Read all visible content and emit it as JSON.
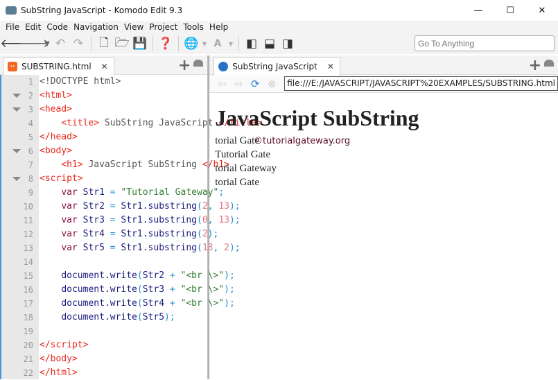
{
  "window": {
    "title": "SubString JavaScript - Komodo Edit 9.3",
    "controls": [
      "—",
      "☐",
      "✕"
    ]
  },
  "menu": [
    "File",
    "Edit",
    "Code",
    "Navigation",
    "View",
    "Project",
    "Tools",
    "Help"
  ],
  "toolbar": {
    "goto_placeholder": "Go To Anything"
  },
  "editor": {
    "tab_label": "SUBSTRING.html",
    "close": "✕",
    "lines": [
      {
        "n": "1",
        "fold": false,
        "tokens": [
          [
            "txt",
            "<!DOCTYPE html>"
          ]
        ]
      },
      {
        "n": "2",
        "fold": true,
        "tokens": [
          [
            "tag",
            "<html>"
          ]
        ]
      },
      {
        "n": "3",
        "fold": true,
        "tokens": [
          [
            "tag",
            "<head>"
          ]
        ]
      },
      {
        "n": "4",
        "fold": false,
        "tokens": [
          [
            "txt",
            "    "
          ],
          [
            "tag",
            "<title>"
          ],
          [
            "txt",
            " SubString JavaScript "
          ],
          [
            "tag",
            "</title>"
          ]
        ]
      },
      {
        "n": "5",
        "fold": false,
        "tokens": [
          [
            "tag",
            "</head>"
          ]
        ]
      },
      {
        "n": "6",
        "fold": true,
        "tokens": [
          [
            "tag",
            "<body>"
          ]
        ]
      },
      {
        "n": "7",
        "fold": false,
        "tokens": [
          [
            "txt",
            "    "
          ],
          [
            "tag",
            "<h1>"
          ],
          [
            "txt",
            " JavaScript SubString "
          ],
          [
            "tag",
            "</h1>"
          ]
        ]
      },
      {
        "n": "8",
        "fold": true,
        "tokens": [
          [
            "tag",
            "<script>"
          ]
        ]
      },
      {
        "n": "9",
        "fold": false,
        "tokens": [
          [
            "txt",
            "    "
          ],
          [
            "kw",
            "var"
          ],
          [
            "id",
            " Str1 "
          ],
          [
            "op",
            "="
          ],
          [
            "str",
            " \"Tutorial Gateway\""
          ],
          [
            "op",
            ";"
          ]
        ]
      },
      {
        "n": "10",
        "fold": false,
        "tokens": [
          [
            "txt",
            "    "
          ],
          [
            "kw",
            "var"
          ],
          [
            "id",
            " Str2 "
          ],
          [
            "op",
            "="
          ],
          [
            "id",
            " Str1.substring"
          ],
          [
            "op",
            "("
          ],
          [
            "num",
            "2"
          ],
          [
            "op",
            ", "
          ],
          [
            "num",
            "13"
          ],
          [
            "op",
            ");"
          ]
        ]
      },
      {
        "n": "11",
        "fold": false,
        "tokens": [
          [
            "txt",
            "    "
          ],
          [
            "kw",
            "var"
          ],
          [
            "id",
            " Str3 "
          ],
          [
            "op",
            "="
          ],
          [
            "id",
            " Str1.substring"
          ],
          [
            "op",
            "("
          ],
          [
            "num",
            "0"
          ],
          [
            "op",
            ", "
          ],
          [
            "num",
            "13"
          ],
          [
            "op",
            ");"
          ]
        ]
      },
      {
        "n": "12",
        "fold": false,
        "tokens": [
          [
            "txt",
            "    "
          ],
          [
            "kw",
            "var"
          ],
          [
            "id",
            " Str4 "
          ],
          [
            "op",
            "="
          ],
          [
            "id",
            " Str1.substring"
          ],
          [
            "op",
            "("
          ],
          [
            "num",
            "2"
          ],
          [
            "op",
            ");"
          ]
        ]
      },
      {
        "n": "13",
        "fold": false,
        "tokens": [
          [
            "txt",
            "    "
          ],
          [
            "kw",
            "var"
          ],
          [
            "id",
            " Str5 "
          ],
          [
            "op",
            "="
          ],
          [
            "id",
            " Str1.substring"
          ],
          [
            "op",
            "("
          ],
          [
            "num",
            "13"
          ],
          [
            "op",
            ", "
          ],
          [
            "num",
            "2"
          ],
          [
            "op",
            ");"
          ]
        ]
      },
      {
        "n": "14",
        "fold": false,
        "tokens": []
      },
      {
        "n": "15",
        "fold": false,
        "tokens": [
          [
            "txt",
            "    "
          ],
          [
            "id",
            "document.write"
          ],
          [
            "op",
            "("
          ],
          [
            "id",
            "Str2 "
          ],
          [
            "op",
            "+"
          ],
          [
            "str",
            " \"<br \\>\""
          ],
          [
            "op",
            ");"
          ]
        ]
      },
      {
        "n": "16",
        "fold": false,
        "tokens": [
          [
            "txt",
            "    "
          ],
          [
            "id",
            "document.write"
          ],
          [
            "op",
            "("
          ],
          [
            "id",
            "Str3 "
          ],
          [
            "op",
            "+"
          ],
          [
            "str",
            " \"<br \\>\""
          ],
          [
            "op",
            ");"
          ]
        ]
      },
      {
        "n": "17",
        "fold": false,
        "tokens": [
          [
            "txt",
            "    "
          ],
          [
            "id",
            "document.write"
          ],
          [
            "op",
            "("
          ],
          [
            "id",
            "Str4 "
          ],
          [
            "op",
            "+"
          ],
          [
            "str",
            " \"<br \\>\""
          ],
          [
            "op",
            ");"
          ]
        ]
      },
      {
        "n": "18",
        "fold": false,
        "tokens": [
          [
            "txt",
            "    "
          ],
          [
            "id",
            "document.write"
          ],
          [
            "op",
            "("
          ],
          [
            "id",
            "Str5"
          ],
          [
            "op",
            ");"
          ]
        ]
      },
      {
        "n": "19",
        "fold": false,
        "tokens": []
      },
      {
        "n": "20",
        "fold": false,
        "tokens": [
          [
            "tag",
            "</script>"
          ]
        ]
      },
      {
        "n": "21",
        "fold": false,
        "tokens": [
          [
            "tag",
            "</body>"
          ]
        ]
      },
      {
        "n": "22",
        "fold": false,
        "tokens": [
          [
            "tag",
            "</html>"
          ]
        ]
      }
    ]
  },
  "watermark": "©tutorialgateway.org",
  "browser": {
    "tab_label": "SubString JavaScript",
    "close": "✕",
    "url": "file:///E:/JAVASCRIPT/JAVASCRIPT%20EXAMPLES/SUBSTRING.html",
    "heading": "JavaScript SubString",
    "output": [
      "torial Gate",
      "Tutorial Gate",
      "torial Gateway",
      "torial Gate"
    ]
  }
}
